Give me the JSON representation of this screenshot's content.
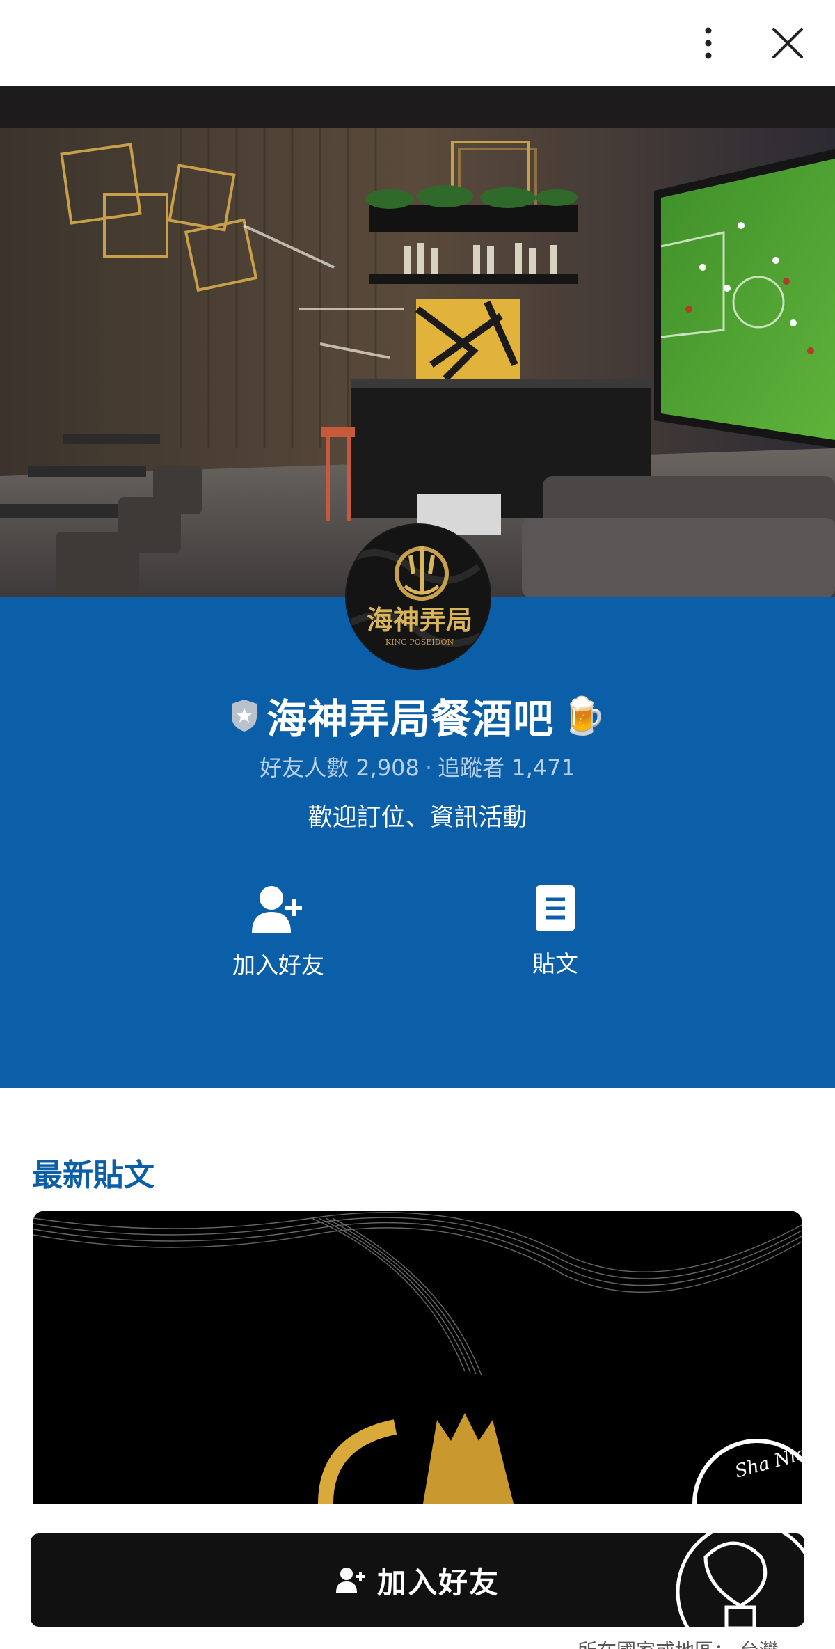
{
  "header": {
    "more_icon": "more-vertical-icon",
    "close_icon": "close-icon"
  },
  "profile": {
    "badge_icon": "verified-shield-icon",
    "name": "海神弄局餐酒吧",
    "name_emoji": "🍺",
    "avatar_text": "海神弄局",
    "avatar_subtext": "KING POSEIDON",
    "friends_label": "好友人數 2,908",
    "followers_label": "追蹤者 1,471",
    "status_message": "歡迎訂位、資訊活動"
  },
  "actions": [
    {
      "label": "加入好友",
      "icon": "add-friend-icon"
    },
    {
      "label": "貼文",
      "icon": "post-document-icon"
    }
  ],
  "latest_posts": {
    "title": "最新貼文",
    "card_watermark": "Sha Nice"
  },
  "cta": {
    "label": "加入好友",
    "icon": "add-friend-icon"
  },
  "footer": {
    "region_note": "所在國家或地區： 台灣"
  },
  "colors": {
    "brand_blue": "#0a5fa8",
    "cta_black": "#111111",
    "gold": "#c9a04a"
  }
}
